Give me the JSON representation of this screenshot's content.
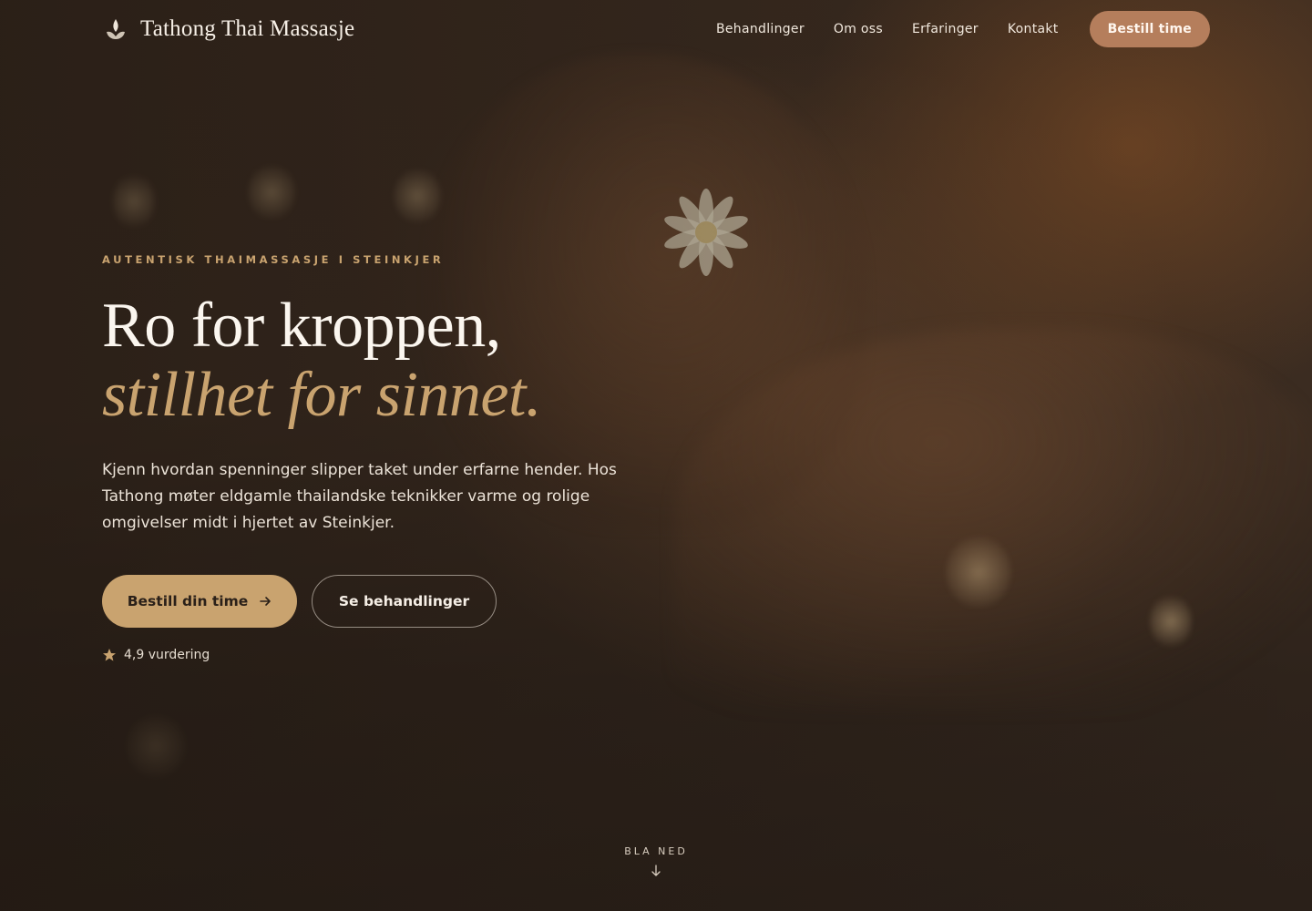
{
  "brand": {
    "name": "Tathong Thai Massasje",
    "logo_icon": "lotus-flame-icon"
  },
  "nav": {
    "links": [
      "Behandlinger",
      "Om oss",
      "Erfaringer",
      "Kontakt"
    ],
    "cta_label": "Bestill time"
  },
  "hero": {
    "eyebrow": "AUTENTISK THAIMASSASJE I STEINKJER",
    "headline_line1": "Ro for kroppen,",
    "headline_line2": "stillhet for sinnet.",
    "lede": "Kjenn hvordan spenninger slipper taket under erfarne hender. Hos Tathong møter eldgamle thailandske teknikker varme og rolige omgivelser midt i hjertet av Steinkjer.",
    "primary_cta": "Bestill din time",
    "secondary_cta": "Se behandlinger",
    "rating_text": "4,9 vurdering",
    "rating_icon": "star-icon"
  },
  "scroll_cue": {
    "label": "BLA NED",
    "icon": "arrow-down-icon"
  },
  "colors": {
    "accent_gold": "#c9a36f",
    "nav_cta": "#b57e5c",
    "background": "#2a2019",
    "text_light": "#f6efe6"
  }
}
